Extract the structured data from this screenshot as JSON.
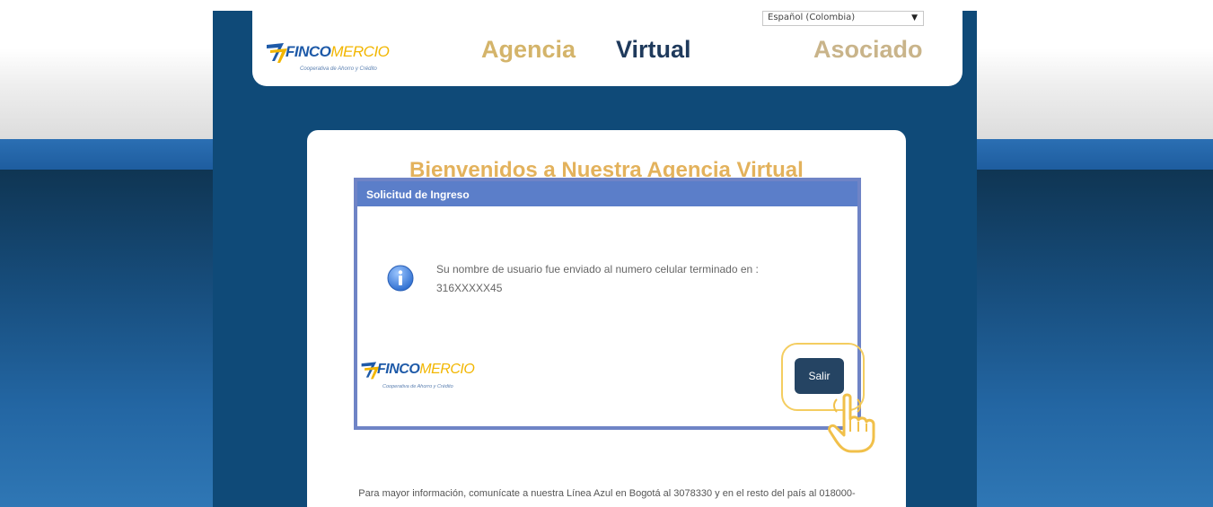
{
  "header": {
    "language": "Español (Colombia)",
    "title_part1": "Agencia",
    "title_part2": "Virtual",
    "title_part3": "Asociado",
    "logo": {
      "brand_part1": "FINCO",
      "brand_part2": "MERCIO",
      "tagline": "Cooperativa de Ahorro y Crédito"
    }
  },
  "main": {
    "welcome_heading": "Bienvenidos a Nuestra Agencia Virtual",
    "footer_line1": "Para mayor información, comunícate a nuestra Línea Azul en Bogotá al 3078330 y en el resto del país al 018000-"
  },
  "dialog": {
    "title": "Solicitud de Ingreso",
    "message": "Su nombre de usuario fue enviado al numero celular terminado en :",
    "phone": "316XXXXX45",
    "button_label": "Salir",
    "icon": "info-icon"
  },
  "colors": {
    "panel_blue": "#0f4a78",
    "dialog_header": "#5b7ec9",
    "button": "#254463",
    "highlight": "#f4cd60",
    "gold_title": "#d4b46a"
  }
}
